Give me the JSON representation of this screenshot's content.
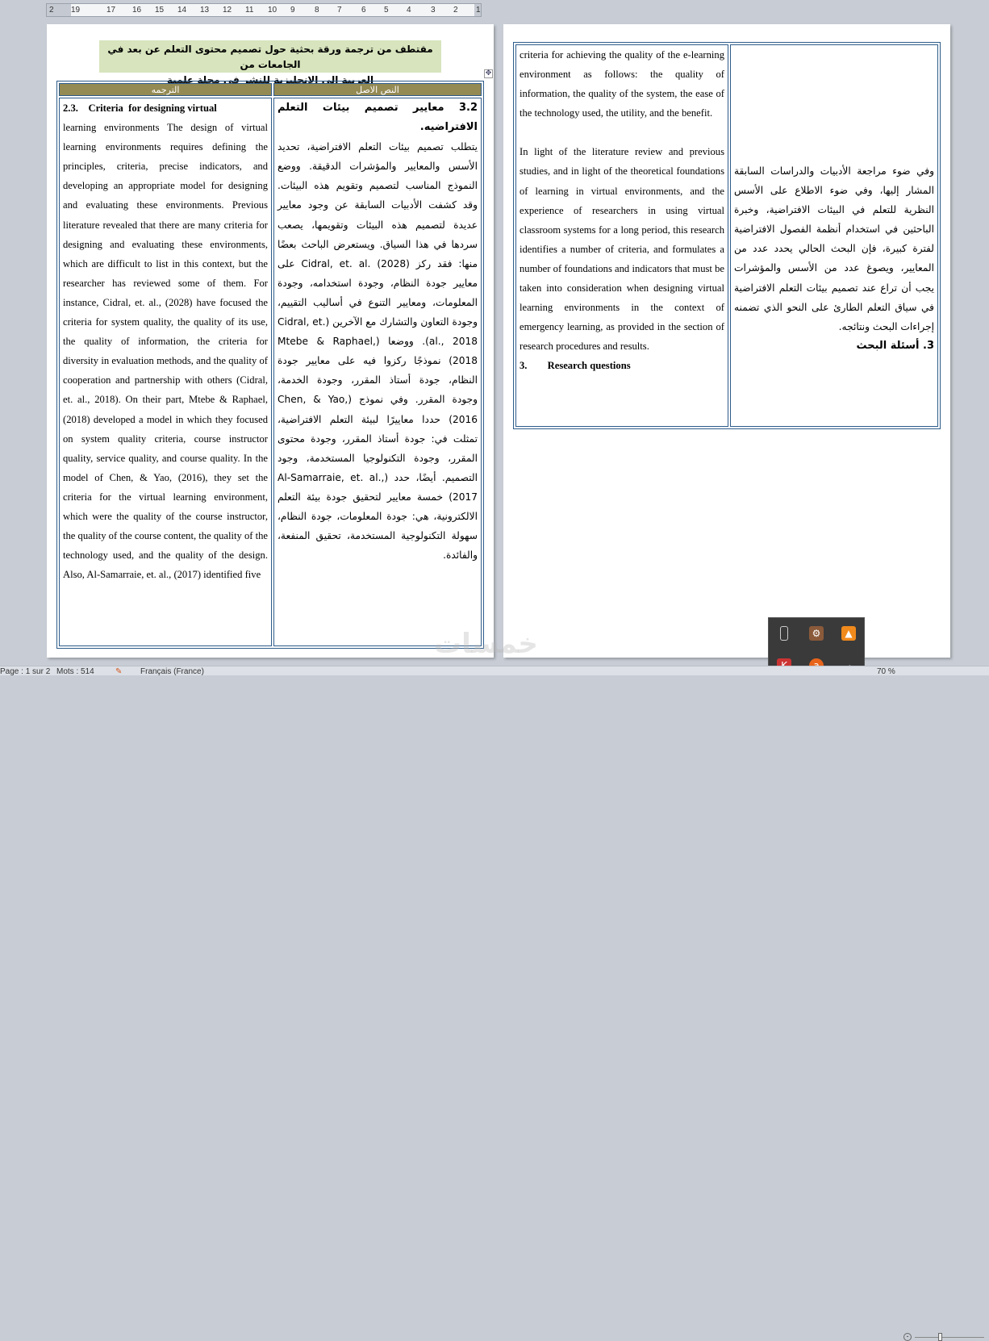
{
  "ruler": {
    "ticks": [
      "2",
      "19",
      "17",
      "16",
      "15",
      "14",
      "13",
      "12",
      "11",
      "10",
      "9",
      "8",
      "7",
      "6",
      "5",
      "4",
      "3",
      "2",
      "1"
    ]
  },
  "header_box": {
    "line1": "مقتطف من ترجمة ورقة بحثية حول تصميم محتوى التعلم عن بعد في الجامعات من",
    "line2": "العربية إلى الإنجليزية للنشر في مجلة علمية"
  },
  "table": {
    "col_translation": "الترجمه",
    "col_original": "النص الاصل",
    "page1_en_heading": "2.3.    Criteria  for designing virtual",
    "page1_en_body": "learning environments The design of virtual learning environments requires defining the principles, criteria, precise indicators, and developing an appropriate model for designing and evaluating these environments. Previous literature revealed that there are many criteria for designing and evaluating these environments, which are difficult to list in this context, but the researcher has reviewed some of them. For instance, Cidral, et. al., (2028) have focused the criteria for system quality, the quality of its use, the quality of information, the criteria for diversity in evaluation methods, and the quality of cooperation and partnership with others (Cidral, et. al., 2018). On their part, Mtebe & Raphael, (2018) developed a model in which they focused on system quality criteria, course instructor quality, service quality, and course quality. In the model of Chen, & Yao, (2016), they set the criteria for the virtual learning environment, which were the quality of the course instructor, the quality of the course content, the quality of the technology used, and the quality of the design. Also, Al-Samarraie, et. al., (2017) identified five",
    "page1_ar_heading": "3.2 معايير تصميم بيئات التعلم الافتراضيه.",
    "page1_ar_body": "يتطلب تصميم بيئات التعلم الافتراضية، تحديد الأسس والمعايير والمؤشرات الدقيقة. ووضع النموذج المناسب لتصميم وتقويم هذه البيئات. وقد كشفت الأدبيات السابقة عن وجود معايير عديدة لتصميم هذه البيئات وتقويمها، يصعب سردها في هذا السياق. ويستعرض الباحث بعضًا منها: فقد ركز Cidral, et. al. (2028) على معايير جودة النظام، وجودة استخدامه، وجودة المعلومات، ومعايير التنوع في أساليب التقييم، وجودة التعاون والتشارك مع الآخرين (Cidral, et. al., 2018). ووضعا (Mtebe & Raphael, 2018) نموذجًا ركزوا فيه على معايير جودة النظام، جودة أستاذ المقرر، وجودة الخدمة، وجودة المقرر. وفي نموذج (Chen, & Yao, 2016) حددا معاييرًا لبيئة التعلم الافتراضية، تمثلت في: جودة أستاذ المقرر، وجودة محتوى المقرر، وجودة التكنولوجيا المستخدمة، وجود التصميم. أيضًا، حدد (Al-Samarraie, et. al., 2017) خمسة معايير لتحقيق جودة بيئة التعلم الالكترونية، هي: جودة المعلومات، جودة النظام، سهولة التكنولوجية المستخدمة، تحقيق المنفعة، والفائدة.",
    "page2_en_p1": "criteria for achieving the quality of the e-learning environment as follows: the quality of information, the quality of the system, the ease of the technology used, the utility, and the benefit.",
    "page2_en_p2": "In light of the literature review and previous studies, and in light of the theoretical foundations of learning in virtual environments, and the experience of researchers in using virtual classroom systems for a long period, this research identifies a number of criteria, and formulates a number of foundations and indicators that must be taken into consideration when designing virtual learning environments in the context of emergency learning, as provided in the section of research procedures and results.",
    "page2_en_h3": "3.        Research questions",
    "page2_ar_p": "وفي ضوء مراجعة الأدبيات والدراسات السابقة المشار إليها، وفي ضوء الاطلاع على الأسس النظرية للتعلم في البيئات الافتراضية، وخبرة الباحثين في استخدام أنظمة الفصول الافتراضية لفترة كبيرة، فإن البحث الحالي يحدد عدد من المعايير، ويصوغ عدد من الأسس والمؤشرات يجب أن تراع عند تصميم بيئات التعلم الافتراضية في سياق التعلم الطارئ على النحو الذي تضمنه إجراءات البحث ونتائجه.",
    "page2_ar_h3": "3. أسئلة البحث"
  },
  "watermark": "خمسات",
  "status": {
    "page": "Page : 1 sur 2",
    "words": "Mots : 514",
    "language": "Français (France)",
    "zoom": "70 %"
  },
  "colors": {
    "header_bg": "#948a54",
    "green_box": "#d7e4bd",
    "border": "#2e5c8a"
  }
}
